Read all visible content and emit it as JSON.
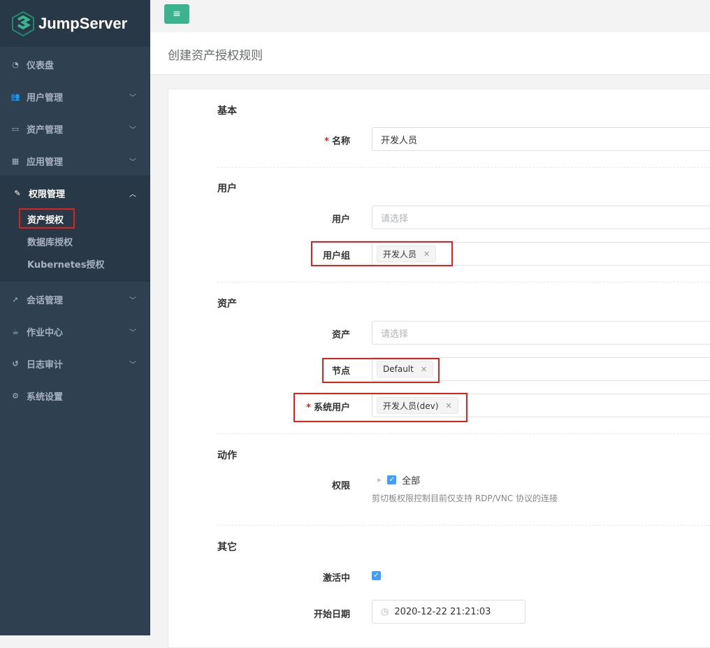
{
  "app": {
    "name": "JumpServer",
    "brand_color": "#3cb38f",
    "sidebar_color": "#2f4050"
  },
  "sidebar": {
    "items": [
      {
        "label": "仪表盘",
        "icon": "dashboard-icon",
        "glyph": "◔"
      },
      {
        "label": "用户管理",
        "icon": "users-icon",
        "glyph": "👥"
      },
      {
        "label": "资产管理",
        "icon": "inbox-icon",
        "glyph": "▭"
      },
      {
        "label": "应用管理",
        "icon": "grid-icon",
        "glyph": "▦"
      },
      {
        "label": "权限管理",
        "icon": "edit-icon",
        "glyph": "✎",
        "expanded": true,
        "children": [
          {
            "label": "资产授权",
            "active": true
          },
          {
            "label": "数据库授权"
          },
          {
            "label": "Kubernetes授权"
          }
        ]
      },
      {
        "label": "会话管理",
        "icon": "rocket-icon",
        "glyph": "➚"
      },
      {
        "label": "作业中心",
        "icon": "coffee-icon",
        "glyph": "☕"
      },
      {
        "label": "日志审计",
        "icon": "history-icon",
        "glyph": "↺"
      },
      {
        "label": "系统设置",
        "icon": "gears-icon",
        "glyph": "⚙"
      }
    ]
  },
  "header": {
    "title": "创建资产授权规则",
    "menu_icon": "≡"
  },
  "form": {
    "sections": {
      "basic": "基本",
      "user": "用户",
      "asset": "资产",
      "action": "动作",
      "other": "其它"
    },
    "name": {
      "label": "名称",
      "value": "开发人员",
      "required": true
    },
    "users": {
      "label": "用户",
      "placeholder": "请选择"
    },
    "user_groups": {
      "label": "用户组",
      "tags": [
        "开发人员"
      ]
    },
    "assets": {
      "label": "资产",
      "placeholder": "请选择"
    },
    "nodes": {
      "label": "节点",
      "tags": [
        "Default"
      ]
    },
    "system_users": {
      "label": "系统用户",
      "tags": [
        "开发人员(dev)"
      ],
      "required": true
    },
    "actions": {
      "label": "权限",
      "option": "全部",
      "checked": true,
      "help": "剪切板权限控制目前仅支持 RDP/VNC 协议的连接"
    },
    "is_active": {
      "label": "激活中",
      "checked": true
    },
    "date_start": {
      "label": "开始日期",
      "value": "2020-12-22 21:21:03"
    }
  }
}
